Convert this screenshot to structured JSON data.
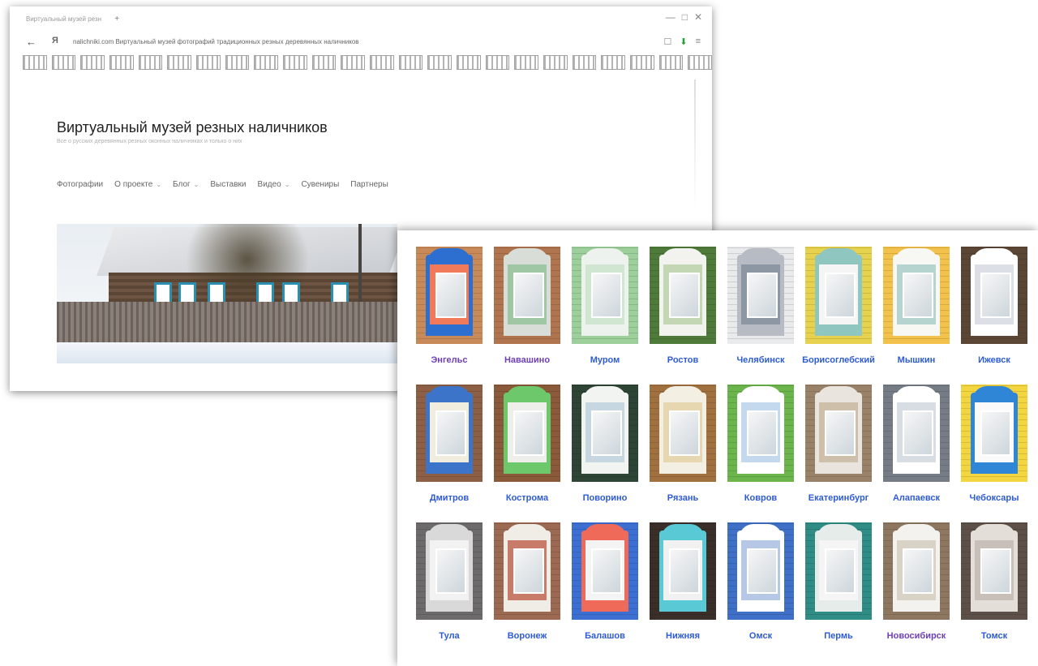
{
  "browser": {
    "tab_text": "Виртуальный музей резн",
    "url": "nalichniki.com Виртуальный музей фотографий традиционных резных деревянных наличников",
    "window_controls": [
      "minimize-icon",
      "maximize-icon",
      "close-icon"
    ],
    "toolbar_icons": [
      "bookmark-icon",
      "download-icon",
      "menu-icon"
    ]
  },
  "site": {
    "title": "Виртуальный музей резных наличников",
    "subtitle": "Все о русских деревянных резных оконных наличниках и только о них",
    "nav": [
      {
        "label": "Фотографии",
        "dropdown": false
      },
      {
        "label": "О проекте",
        "dropdown": true
      },
      {
        "label": "Блог",
        "dropdown": true
      },
      {
        "label": "Выставки",
        "dropdown": false
      },
      {
        "label": "Видео",
        "dropdown": true
      },
      {
        "label": "Сувениры",
        "dropdown": false
      },
      {
        "label": "Партнеры",
        "dropdown": false
      }
    ]
  },
  "cities": [
    {
      "name": "Энгельс",
      "wall": "#c98a5a",
      "trim": "#2d6fd0",
      "accent": "#f07a5a",
      "visited": true
    },
    {
      "name": "Навашино",
      "wall": "#b0744f",
      "trim": "#d8ddd8",
      "accent": "#9fc7a4",
      "visited": true
    },
    {
      "name": "Муром",
      "wall": "#9ccf9a",
      "trim": "#eef2ee",
      "accent": "#d0e6d0",
      "visited": false
    },
    {
      "name": "Ростов",
      "wall": "#4e7a3a",
      "trim": "#f2f2ef",
      "accent": "#c4d7b5",
      "visited": false
    },
    {
      "name": "Челябинск",
      "wall": "#e9eaec",
      "trim": "#b7bcc4",
      "accent": "#8d96a3",
      "visited": false
    },
    {
      "name": "Борисоглебский",
      "wall": "#e6d24f",
      "trim": "#8fc7c0",
      "accent": "#f5f5f5",
      "visited": false
    },
    {
      "name": "Мышкин",
      "wall": "#f2c24c",
      "trim": "#f7f7f4",
      "accent": "#b6d4cf",
      "visited": false
    },
    {
      "name": "Ижевск",
      "wall": "#5b4636",
      "trim": "#ffffff",
      "accent": "#dcdfe6",
      "visited": false
    },
    {
      "name": "Дмитров",
      "wall": "#8d5f45",
      "trim": "#3b74c9",
      "accent": "#f0ecde",
      "visited": false
    },
    {
      "name": "Кострома",
      "wall": "#8a5a3b",
      "trim": "#6dc86b",
      "accent": "#eeeeea",
      "visited": false
    },
    {
      "name": "Поворино",
      "wall": "#2e4536",
      "trim": "#f2f4f2",
      "accent": "#c7d7e2",
      "visited": false
    },
    {
      "name": "Рязань",
      "wall": "#a0703f",
      "trim": "#f3efe3",
      "accent": "#e6d7b0",
      "visited": false
    },
    {
      "name": "Ковров",
      "wall": "#6bb54c",
      "trim": "#ffffff",
      "accent": "#c4d9ee",
      "visited": false
    },
    {
      "name": "Екатеринбург",
      "wall": "#9a8268",
      "trim": "#e9e5de",
      "accent": "#cdbfa9",
      "visited": false
    },
    {
      "name": "Алапаевск",
      "wall": "#767c86",
      "trim": "#ffffff",
      "accent": "#d8dde4",
      "visited": false
    },
    {
      "name": "Чебоксары",
      "wall": "#f3d53f",
      "trim": "#2f86d6",
      "accent": "#fafafa",
      "visited": false
    },
    {
      "name": "Тула",
      "wall": "#6c6a6a",
      "trim": "#d9d9d9",
      "accent": "#f2f2f2",
      "visited": false
    },
    {
      "name": "Воронеж",
      "wall": "#9c6a52",
      "trim": "#f0ece6",
      "accent": "#c97b6a",
      "visited": false
    },
    {
      "name": "Балашов",
      "wall": "#3d6fd3",
      "trim": "#f06a5a",
      "accent": "#f4f4f4",
      "visited": false
    },
    {
      "name": "Нижняя",
      "wall": "#3a2e28",
      "trim": "#59c9d6",
      "accent": "#f1f1f1",
      "visited": false
    },
    {
      "name": "Омск",
      "wall": "#3f6fc6",
      "trim": "#ffffff",
      "accent": "#b7c7e6",
      "visited": false
    },
    {
      "name": "Пермь",
      "wall": "#2f8d86",
      "trim": "#e6ecea",
      "accent": "#f5f5f5",
      "visited": false
    },
    {
      "name": "Новосибирск",
      "wall": "#8e7760",
      "trim": "#f4f2ef",
      "accent": "#d9d2c6",
      "visited": true
    },
    {
      "name": "Томск",
      "wall": "#5d5048",
      "trim": "#e3ded8",
      "accent": "#c8c0b8",
      "visited": false
    }
  ]
}
